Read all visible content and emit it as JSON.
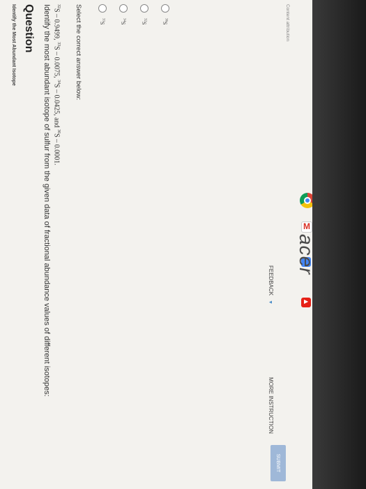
{
  "breadcrumb": "Identify the Most Abundant Isotope",
  "question_title": "Question",
  "question_text": "Identify the most abundant isotope of sulfur from the given data of fractional abundance values of different isotopes:",
  "question_data": {
    "i1_mass": "32",
    "i1_rest": "S – 0.9499, ",
    "i2_mass": "33",
    "i2_rest": "S – 0.0075, ",
    "i3_mass": "34",
    "i3_rest": "S – 0.0425, and ",
    "i4_mass": "36",
    "i4_rest": "S – 0.0001."
  },
  "prompt": "Select the correct answer below:",
  "options": [
    {
      "mass": "33",
      "symbol": "S"
    },
    {
      "mass": "34",
      "symbol": "S"
    },
    {
      "mass": "32",
      "symbol": "S"
    },
    {
      "mass": "36",
      "symbol": "S"
    }
  ],
  "feedback_label": "FEEDBACK",
  "instructions_label": "MORE INSTRUCTION",
  "submit_label": "SUBMIT",
  "attribution": "Content attribution",
  "laptop_brand": "acer",
  "icons": [
    "chrome-icon",
    "gmail-icon",
    "docs-icon",
    "youtube-icon"
  ]
}
